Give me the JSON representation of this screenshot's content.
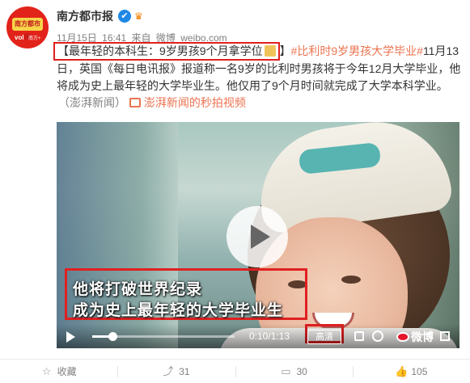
{
  "author": {
    "name": "南方都市报",
    "avatar_logo_text": "南方都市报",
    "avatar_badge": "vol",
    "avatar_badge_plus": "南方+"
  },
  "meta": {
    "date": "11月15日",
    "time": "16:41",
    "from_label": "来自",
    "client": "微博",
    "site": "weibo.com"
  },
  "post": {
    "headline": "【最年轻的本科生：9岁男孩9个月拿学位",
    "headline_close": "】",
    "hashtag": "#比利时9岁男孩大学毕业#",
    "body": "11月13日，英国《每日电讯报》报道称一名9岁的比利时男孩将于今年12月大学毕业，他将成为史上最年轻的大学毕业生。他仅用了9个月时间就完成了大学本科学业。",
    "source": "（澎湃新闻）",
    "video_link": "澎湃新闻的秒拍视频"
  },
  "video": {
    "subtitle_line1": "他将打破世界纪录",
    "subtitle_line2": "成为史上最年轻的大学毕业生",
    "time": "0:10/1:13",
    "progress": 0.14,
    "quality": "高清",
    "watermark": "微博"
  },
  "actions": {
    "favorite": "收藏",
    "repost": "31",
    "comment": "30",
    "like": "105"
  },
  "colors": {
    "link": "#eb7350",
    "highlight_border": "#e02020",
    "meta_gray": "#808080"
  }
}
